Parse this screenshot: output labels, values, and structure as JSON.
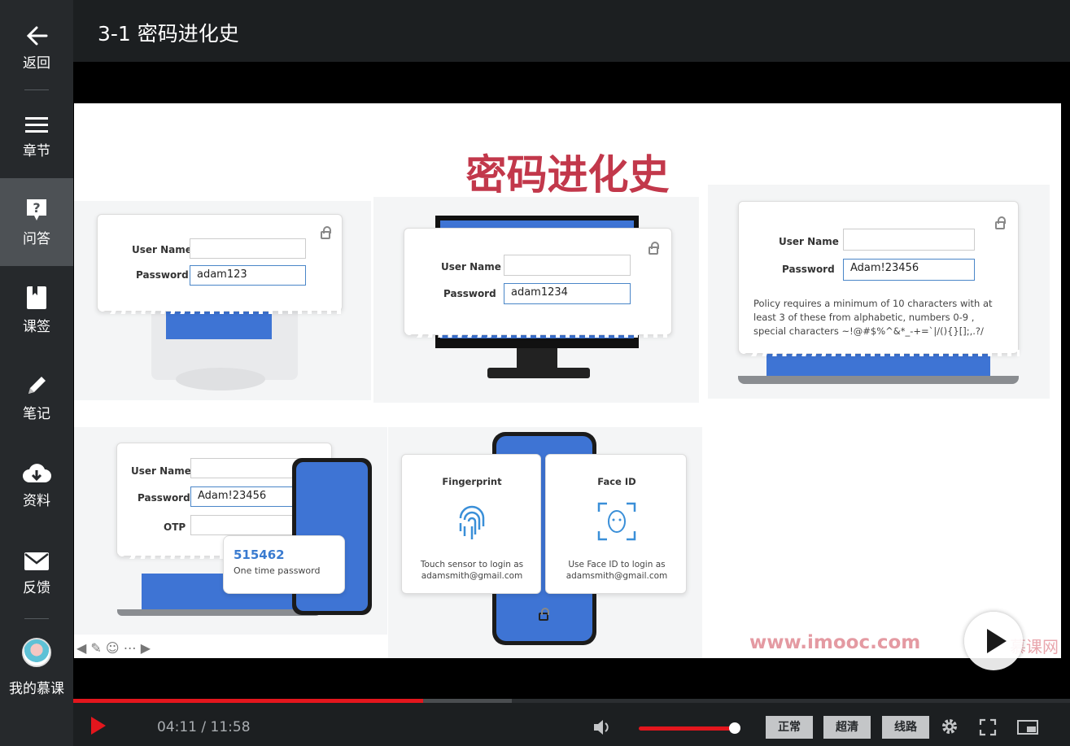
{
  "app": {
    "title": "3-1 密码进化史"
  },
  "sidebar": {
    "back": "返回",
    "items": [
      {
        "label": "章节",
        "icon": "menu-icon"
      },
      {
        "label": "问答",
        "icon": "question-icon"
      },
      {
        "label": "课签",
        "icon": "bookmark-icon"
      },
      {
        "label": "笔记",
        "icon": "pencil-icon"
      },
      {
        "label": "资料",
        "icon": "cloud-download-icon"
      },
      {
        "label": "反馈",
        "icon": "mail-icon"
      }
    ],
    "profile": "我的慕课"
  },
  "slide": {
    "title": "密码进化史",
    "panel1": {
      "user_label": "User Name",
      "pass_label": "Password",
      "pass_value": "adam123"
    },
    "panel2": {
      "user_label": "User Name",
      "pass_label": "Password",
      "pass_value": "adam1234"
    },
    "panel3": {
      "user_label": "User Name",
      "pass_label": "Password",
      "pass_value": "Adam!23456",
      "policy": "Policy requires a minimum of 10  characters with at least 3 of these from alphabetic, numbers 0-9 , special characters ~!@#$%^&*_-+=`|/(){}[];,.?/"
    },
    "panel4": {
      "user_label": "User Name",
      "pass_label": "Password",
      "pass_value": "Adam!23456",
      "otp_label": "OTP",
      "otp_code": "515462",
      "otp_caption": "One time password"
    },
    "panel5": {
      "fp_title": "Fingerprint",
      "fp_text": "Touch sensor to login as adamsmith@gmail.com",
      "face_title": "Face ID",
      "face_text": "Use Face ID to login as adamsmith@gmail.com"
    },
    "watermark": "www.imooc.com",
    "watermark2": "慕课网"
  },
  "player": {
    "current": "04:11",
    "separator": " / ",
    "total": "11:58",
    "progress": 0.351,
    "buffered": 0.44,
    "volume": 0.95,
    "btn_speed": "正常",
    "btn_quality": "超清",
    "btn_line": "线路",
    "accent": "#e3161d"
  }
}
